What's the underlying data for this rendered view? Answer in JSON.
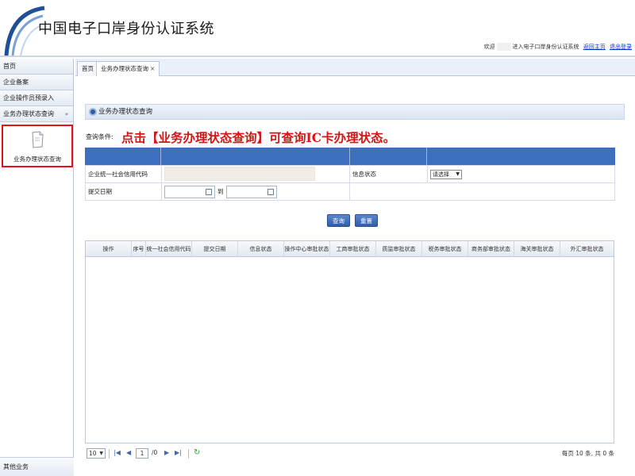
{
  "header": {
    "title": "中国电子口岸身份认证系统",
    "welcome": "欢迎",
    "welcome_suffix": "进入电子口岸身份认证系统",
    "home_link": "返回主页",
    "logout_link": "退出登录"
  },
  "sidebar": {
    "items": [
      {
        "label": "首页"
      },
      {
        "label": "企业备案"
      },
      {
        "label": "企业操作员预录入"
      },
      {
        "label": "业务办理状态查询",
        "arrows": "»"
      }
    ],
    "sub_item": "业务办理状态查询",
    "bottom": "其他业务"
  },
  "tabs": [
    {
      "label": "首页"
    },
    {
      "label": "业务办理状态查询",
      "close": "×"
    }
  ],
  "section": {
    "title": "业务办理状态查询"
  },
  "query": {
    "label": "查询条件:",
    "instruction": "点击【业务办理状态查询】可查询IC卡办理状态。"
  },
  "form": {
    "credit_code_label": "企业统一社会信用代码",
    "info_status_label": "信息状态",
    "info_status_value": "请选择",
    "date_label": "提交日期",
    "date_to": "到"
  },
  "buttons": {
    "query": "查询",
    "reset": "重置"
  },
  "grid": {
    "columns": [
      "操作",
      "序号",
      "统一社会信用代码",
      "提交日期",
      "信息状态",
      "操作中心审批状态",
      "工商审批状态",
      "质监审批状态",
      "税务审批状态",
      "商务部审批状态",
      "海关审批状态",
      "外汇审批状态"
    ]
  },
  "pager": {
    "page_size": "10",
    "first": "|◀",
    "prev": "◀",
    "page": "1",
    "of": "/0",
    "next": "▶",
    "last": "▶|",
    "refresh": "↻",
    "info": "每页 10 条, 共 0 条"
  },
  "colors": {
    "accent_blue": "#3e6fbe",
    "instruction_red": "#d51515",
    "highlight_border": "#e0121b"
  }
}
